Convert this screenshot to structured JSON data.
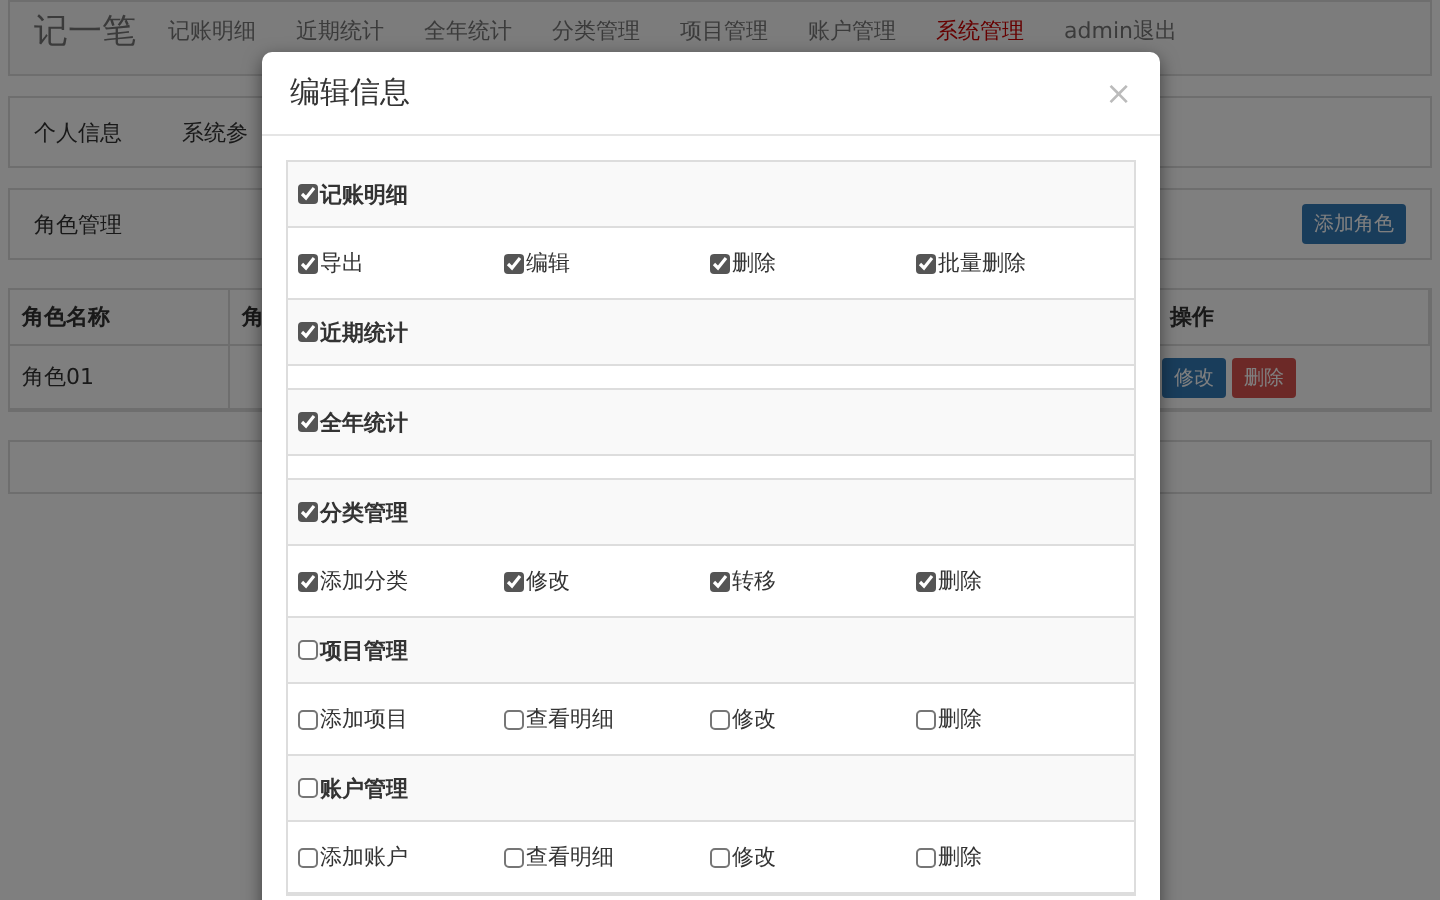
{
  "navbar": {
    "brand": "记一笔",
    "items": [
      {
        "label": "记账明细",
        "selected": false
      },
      {
        "label": "近期统计",
        "selected": false
      },
      {
        "label": "全年统计",
        "selected": false
      },
      {
        "label": "分类管理",
        "selected": false
      },
      {
        "label": "项目管理",
        "selected": false
      },
      {
        "label": "账户管理",
        "selected": false
      },
      {
        "label": "系统管理",
        "selected": true
      },
      {
        "label": "admin退出",
        "selected": false
      }
    ]
  },
  "subnav": {
    "items": [
      {
        "label": "个人信息"
      },
      {
        "label": "系统参"
      }
    ]
  },
  "role_panel": {
    "title": "角色管理",
    "add_button": "添加角色"
  },
  "table": {
    "columns": [
      "角色名称",
      "角",
      "操作"
    ],
    "rows": [
      {
        "cells": [
          "角色01"
        ],
        "actions": [
          {
            "label": "修改",
            "kind": "edit"
          },
          {
            "label": "删除",
            "kind": "delete"
          }
        ]
      }
    ]
  },
  "modal": {
    "title": "编辑信息",
    "close": "×",
    "groups": [
      {
        "label": "记账明细",
        "checked": true,
        "items": [
          {
            "label": "导出",
            "checked": true
          },
          {
            "label": "编辑",
            "checked": true
          },
          {
            "label": "删除",
            "checked": true
          },
          {
            "label": "批量删除",
            "checked": true
          }
        ]
      },
      {
        "label": "近期统计",
        "checked": true
      },
      {
        "label": "全年统计",
        "checked": true
      },
      {
        "label": "分类管理",
        "checked": true,
        "items": [
          {
            "label": "添加分类",
            "checked": true
          },
          {
            "label": "修改",
            "checked": true
          },
          {
            "label": "转移",
            "checked": true
          },
          {
            "label": "删除",
            "checked": true
          }
        ]
      },
      {
        "label": "项目管理",
        "checked": false,
        "items": [
          {
            "label": "添加项目",
            "checked": false
          },
          {
            "label": "查看明细",
            "checked": false
          },
          {
            "label": "修改",
            "checked": false
          },
          {
            "label": "删除",
            "checked": false
          }
        ]
      },
      {
        "label": "账户管理",
        "checked": false,
        "items": [
          {
            "label": "添加账户",
            "checked": false
          },
          {
            "label": "查看明细",
            "checked": false
          },
          {
            "label": "修改",
            "checked": false
          },
          {
            "label": "删除",
            "checked": false
          }
        ]
      }
    ]
  }
}
